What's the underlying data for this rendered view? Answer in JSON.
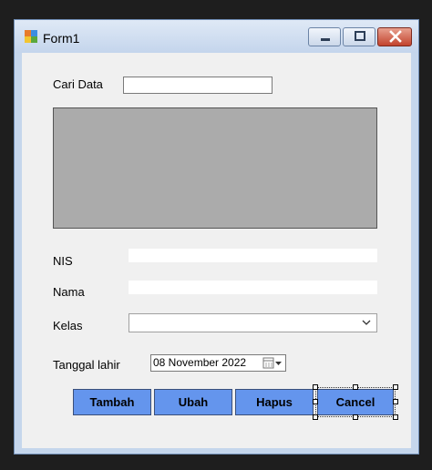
{
  "window": {
    "title": "Form1"
  },
  "form": {
    "search_label": "Cari Data",
    "search_value": "",
    "nis_label": "NIS",
    "nis_value": "",
    "nama_label": "Nama",
    "nama_value": "",
    "kelas_label": "Kelas",
    "kelas_value": "",
    "tanggal_label": "Tanggal lahir",
    "tanggal_value": "08  November  2022"
  },
  "buttons": {
    "tambah": "Tambah",
    "ubah": "Ubah",
    "hapus": "Hapus",
    "cancel": "Cancel"
  },
  "colors": {
    "button_blue": "#6495ed",
    "grid_gray": "#ababab"
  }
}
